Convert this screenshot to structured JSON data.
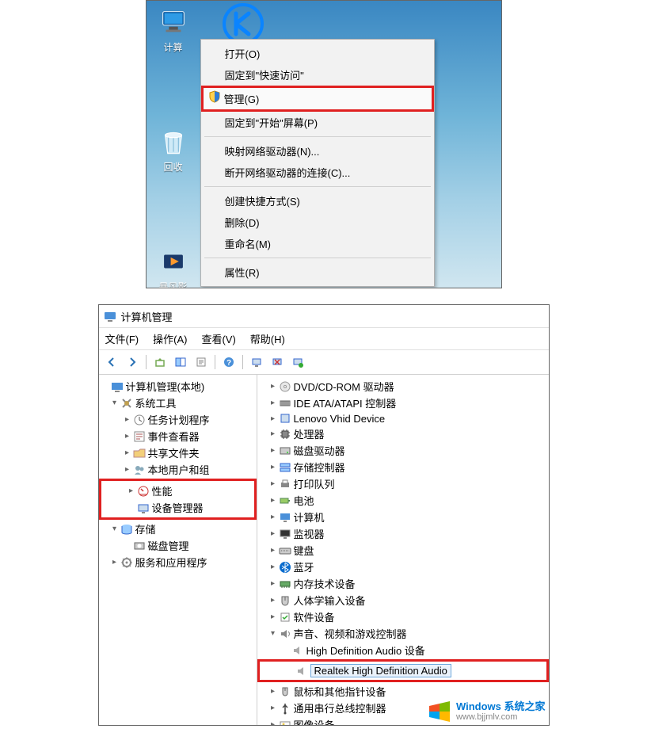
{
  "context_menu": {
    "desktop_icons": [
      {
        "name": "computer",
        "label": "计算"
      },
      {
        "name": "recycle",
        "label": "回收"
      },
      {
        "name": "storm",
        "label": "暴风影"
      }
    ],
    "items": [
      {
        "id": "open",
        "label": "打开(O)",
        "shield": false,
        "hl": false
      },
      {
        "id": "pin-quick",
        "label": "固定到\"快速访问\"",
        "shield": false,
        "hl": false
      },
      {
        "id": "manage",
        "label": "管理(G)",
        "shield": true,
        "hl": true
      },
      {
        "id": "pin-start",
        "label": "固定到\"开始\"屏幕(P)",
        "shield": false,
        "hl": false
      },
      {
        "sep": true
      },
      {
        "id": "map-drive",
        "label": "映射网络驱动器(N)...",
        "shield": false,
        "hl": false
      },
      {
        "id": "disconnect",
        "label": "断开网络驱动器的连接(C)...",
        "shield": false,
        "hl": false
      },
      {
        "sep": true
      },
      {
        "id": "shortcut",
        "label": "创建快捷方式(S)",
        "shield": false,
        "hl": false
      },
      {
        "id": "delete",
        "label": "删除(D)",
        "shield": false,
        "hl": false
      },
      {
        "id": "rename",
        "label": "重命名(M)",
        "shield": false,
        "hl": false
      },
      {
        "sep": true
      },
      {
        "id": "props",
        "label": "属性(R)",
        "shield": false,
        "hl": false
      }
    ]
  },
  "mgmt": {
    "title": "计算机管理",
    "menus": [
      "文件(F)",
      "操作(A)",
      "查看(V)",
      "帮助(H)"
    ],
    "left_tree": [
      {
        "exp": "",
        "ind": 0,
        "icon": "root",
        "label": "计算机管理(本地)"
      },
      {
        "exp": "v",
        "ind": 1,
        "icon": "tools",
        "label": "系统工具"
      },
      {
        "exp": ">",
        "ind": 2,
        "icon": "task",
        "label": "任务计划程序"
      },
      {
        "exp": ">",
        "ind": 2,
        "icon": "event",
        "label": "事件查看器"
      },
      {
        "exp": ">",
        "ind": 2,
        "icon": "share",
        "label": "共享文件夹"
      },
      {
        "exp": ">",
        "ind": 2,
        "icon": "users",
        "label": "本地用户和组"
      },
      {
        "hl_start": true
      },
      {
        "exp": ">",
        "ind": 2,
        "icon": "perf",
        "label": "性能"
      },
      {
        "exp": "",
        "ind": 2,
        "icon": "devmgr",
        "label": "设备管理器"
      },
      {
        "hl_end": true
      },
      {
        "exp": "v",
        "ind": 1,
        "icon": "storage",
        "label": "存储"
      },
      {
        "exp": "",
        "ind": 2,
        "icon": "disk",
        "label": "磁盘管理"
      },
      {
        "exp": ">",
        "ind": 1,
        "icon": "services",
        "label": "服务和应用程序"
      }
    ],
    "right_tree": [
      {
        "exp": ">",
        "icon": "dvd",
        "label": "DVD/CD-ROM 驱动器"
      },
      {
        "exp": ">",
        "icon": "ide",
        "label": "IDE ATA/ATAPI 控制器"
      },
      {
        "exp": ">",
        "icon": "dev",
        "label": "Lenovo Vhid Device"
      },
      {
        "exp": ">",
        "icon": "cpu",
        "label": "处理器"
      },
      {
        "exp": ">",
        "icon": "hdd",
        "label": "磁盘驱动器"
      },
      {
        "exp": ">",
        "icon": "stor",
        "label": "存储控制器"
      },
      {
        "exp": ">",
        "icon": "printq",
        "label": "打印队列"
      },
      {
        "exp": ">",
        "icon": "batt",
        "label": "电池"
      },
      {
        "exp": ">",
        "icon": "pc",
        "label": "计算机"
      },
      {
        "exp": ">",
        "icon": "monitor",
        "label": "监视器"
      },
      {
        "exp": ">",
        "icon": "kbd",
        "label": "键盘"
      },
      {
        "exp": ">",
        "icon": "bt",
        "label": "蓝牙"
      },
      {
        "exp": ">",
        "icon": "mem",
        "label": "内存技术设备"
      },
      {
        "exp": ">",
        "icon": "hid",
        "label": "人体学输入设备"
      },
      {
        "exp": ">",
        "icon": "soft",
        "label": "软件设备"
      },
      {
        "exp": "v",
        "icon": "snd",
        "label": "声音、视频和游戏控制器"
      },
      {
        "exp": "",
        "icon": "spk",
        "label": "High Definition Audio 设备",
        "child": true
      },
      {
        "exp": "",
        "icon": "spk",
        "label": "Realtek High Definition Audio",
        "child": true,
        "hl": true,
        "sel": true
      },
      {
        "exp": ">",
        "icon": "mouse",
        "label": "鼠标和其他指针设备"
      },
      {
        "exp": ">",
        "icon": "usb",
        "label": "通用串行总线控制器"
      },
      {
        "exp": ">",
        "icon": "img",
        "label": "图像设备"
      }
    ]
  },
  "watermark": {
    "brand": "Windows 系统之家",
    "url": "www.bjjmlv.com"
  }
}
